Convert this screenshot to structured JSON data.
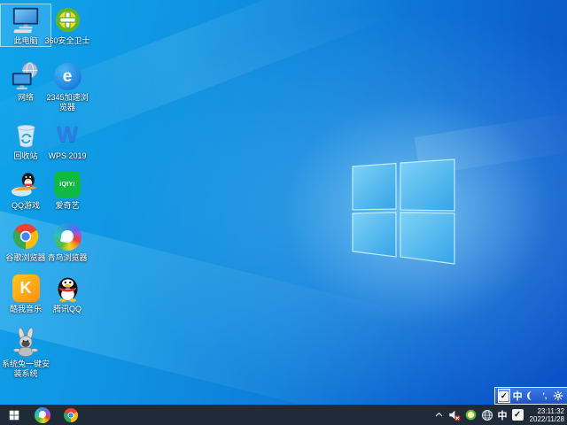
{
  "desktop": {
    "icons": [
      {
        "name": "this-pc",
        "label": "此电脑",
        "selected": true
      },
      {
        "name": "360-security",
        "label": "360安全卫士"
      },
      {
        "name": "network",
        "label": "网络"
      },
      {
        "name": "2345-browser",
        "label": "2345加速浏览器",
        "icon_text": "e"
      },
      {
        "name": "recycle-bin",
        "label": "回收站"
      },
      {
        "name": "wps-2019",
        "label": "WPS 2019",
        "icon_text": "W"
      },
      {
        "name": "qq-games",
        "label": "QQ游戏"
      },
      {
        "name": "iqiyi",
        "label": "爱奇艺",
        "icon_text": "iQIYI"
      },
      {
        "name": "chrome-browser",
        "label": "谷歌浏览器"
      },
      {
        "name": "bird-browser",
        "label": "青鸟浏览器"
      },
      {
        "name": "kuwo-music",
        "label": "酷我音乐",
        "icon_text": "K"
      },
      {
        "name": "tencent-qq",
        "label": "腾讯QQ"
      },
      {
        "name": "system-rabbit",
        "label": "系统兔一键安装系统"
      }
    ]
  },
  "taskbar": {
    "pinned_apps": [
      "bird-browser",
      "chrome-browser"
    ],
    "tray": {
      "chinese_indicator": "中",
      "time": "23:11:32",
      "date": "2022/11/28"
    }
  },
  "ime": {
    "check": "✓"
  },
  "language_bar": {
    "chinese_mode": "中",
    "punctuation": "’,"
  },
  "colors": {
    "wallpaper_light": "#0ea4ea",
    "wallpaper_dark": "#0b4fc5",
    "taskbar": "#1f2b39",
    "language_bar": "#2a63d6",
    "logo_pane": "#45b5f0"
  }
}
